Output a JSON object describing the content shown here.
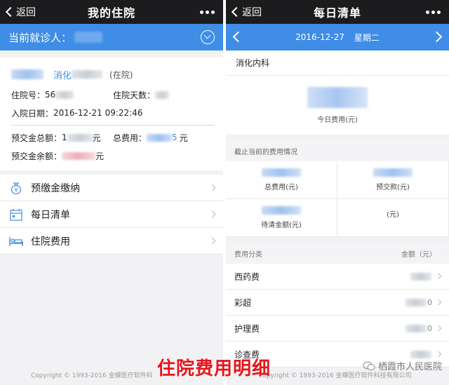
{
  "left": {
    "nav": {
      "back": "返回",
      "title": "我的住院"
    },
    "patient_label": "当前就诊人：",
    "dept": "消化",
    "status": "(在院)",
    "info": {
      "hospital_no_label": "住院号：",
      "hospital_no_partial": "56",
      "days_label": "住院天数：",
      "admit_label": "入院日期：",
      "admit_date": "2016-12-21 09:22:46",
      "deposit_total_label": "预交金总额：",
      "deposit_total_partial": "1",
      "deposit_total_unit": "元",
      "total_fee_label": "总费用：",
      "total_fee_partial": "5",
      "total_fee_unit": "元",
      "deposit_balance_label": "预交金余额：",
      "deposit_balance_unit": "元"
    },
    "menu": [
      {
        "label": "预缴金缴纳",
        "icon": "money-bag-icon"
      },
      {
        "label": "每日清单",
        "icon": "calendar-icon"
      },
      {
        "label": "住院费用",
        "icon": "hospital-bed-icon"
      }
    ],
    "copyright": "Copyright © 1993-2016 金蝶医疗软件科"
  },
  "right": {
    "nav": {
      "back": "返回",
      "title": "每日清单"
    },
    "date": "2016-12-27",
    "weekday": "星期二",
    "dept": "消化内科",
    "today_fee_label": "今日费用(元)",
    "section_title": "截止当前的费用情况",
    "stats": [
      {
        "label": "总费用(元)",
        "tone": "blue"
      },
      {
        "label": "预交款(元)",
        "tone": "blue"
      },
      {
        "label": "待清金额(元)",
        "tone": "blue"
      },
      {
        "label": "(元)",
        "tone": "none"
      }
    ],
    "fee_head": {
      "category": "费用分类",
      "amount": "金额（元）"
    },
    "fees": [
      {
        "name": "西药费",
        "amount_partial": ""
      },
      {
        "name": "彩超",
        "amount_partial": "0"
      },
      {
        "name": "护理费",
        "amount_partial": "0"
      },
      {
        "name": "诊查费",
        "amount_partial": ""
      }
    ],
    "copyright": "Copyright © 1993-2016 金蝶医疗软件科技有限公司"
  },
  "caption": "住院费用明细",
  "watermark": "栖霞市人民医院",
  "colors": {
    "accent": "#3f8de6",
    "navbar": "#1c1c1e",
    "caption": "#e8141b"
  }
}
